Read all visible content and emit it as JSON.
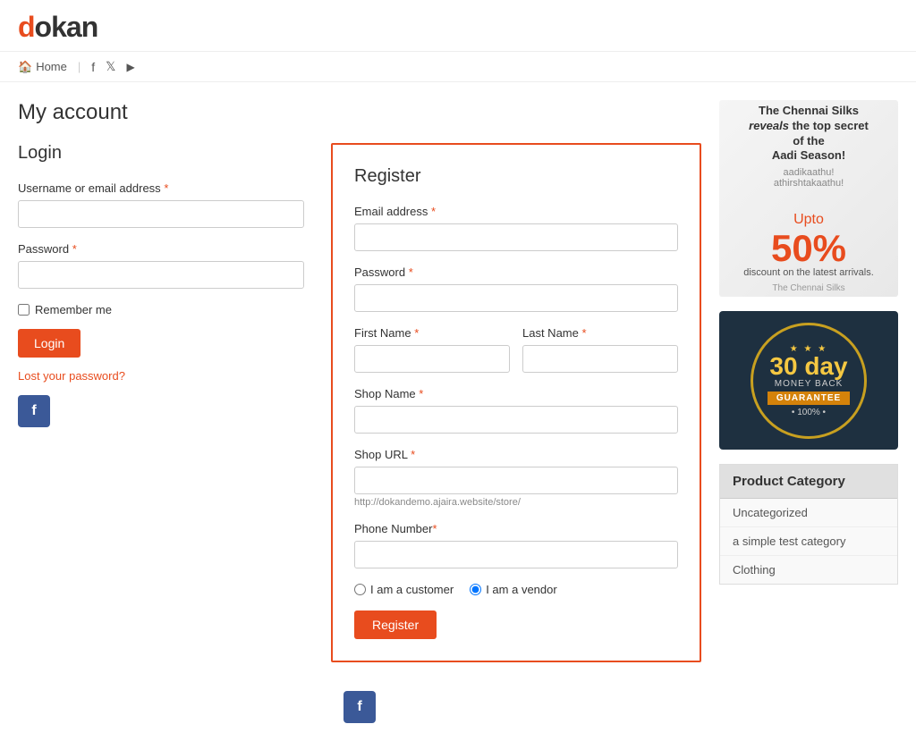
{
  "site": {
    "logo": "dokan",
    "logo_d": "d"
  },
  "nav": {
    "home": "Home",
    "home_icon": "🏠",
    "fb_icon": "f",
    "twitter_icon": "t",
    "youtube_icon": "▶"
  },
  "page": {
    "title": "My account"
  },
  "login": {
    "section_title": "Login",
    "username_label": "Username or email address",
    "password_label": "Password",
    "remember_label": "Remember me",
    "login_button": "Login",
    "lost_password": "Lost your password?",
    "username_placeholder": "",
    "password_placeholder": ""
  },
  "register": {
    "section_title": "Register",
    "email_label": "Email address",
    "email_placeholder": "",
    "password_label": "Password",
    "password_placeholder": "",
    "first_name_label": "First Name",
    "first_name_placeholder": "",
    "last_name_label": "Last Name",
    "last_name_placeholder": "",
    "shop_name_label": "Shop Name",
    "shop_name_placeholder": "",
    "shop_url_label": "Shop URL",
    "shop_url_placeholder": "",
    "shop_url_hint": "http://dokandemo.ajaira.website/store/",
    "phone_label": "Phone Number",
    "phone_placeholder": "",
    "customer_option": "I am a customer",
    "vendor_option": "I am a vendor",
    "register_button": "Register"
  },
  "ad": {
    "headline1": "The Chennai Silks",
    "headline2": "reveals",
    "headline3": "the top secret",
    "headline4": "of the",
    "headline5": "Aadi Season!",
    "percent": "50%",
    "discount_text": "discount on the latest arrivals.",
    "brand": "The Chennai Silks"
  },
  "guarantee": {
    "stars": "★ ★ ★",
    "days": "30 day",
    "money_back": "MONEY BACK",
    "guarantee": "GUARANTEE",
    "percent": "• 100% •"
  },
  "product_category": {
    "title": "Product Category",
    "items": [
      {
        "label": "Uncategorized"
      },
      {
        "label": "a simple test category"
      },
      {
        "label": "Clothing"
      }
    ]
  }
}
